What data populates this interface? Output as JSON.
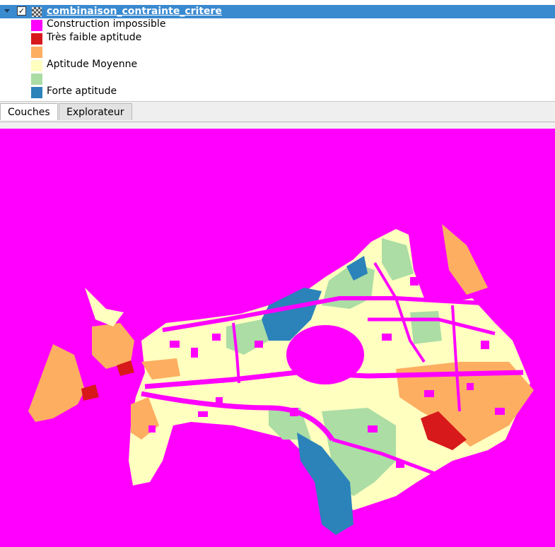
{
  "layer_tree": {
    "layer_name": "combinaison_contrainte_critere",
    "checked": true,
    "legend": [
      {
        "label": "Construction impossible",
        "color": "#ff00ff"
      },
      {
        "label": "Très faible aptitude",
        "color": "#d7191c"
      },
      {
        "label": "",
        "color": "#fdae61"
      },
      {
        "label": "Aptitude Moyenne",
        "color": "#ffffc0"
      },
      {
        "label": "",
        "color": "#abdda4"
      },
      {
        "label": "Forte aptitude",
        "color": "#2b83ba"
      }
    ]
  },
  "tabs": [
    {
      "label": "Couches",
      "active": true
    },
    {
      "label": "Explorateur",
      "active": false
    }
  ],
  "icons": {
    "expand": "chevron-down-icon",
    "checkbox": "checkbox-checked-icon",
    "layer_type": "raster-layer-icon"
  }
}
